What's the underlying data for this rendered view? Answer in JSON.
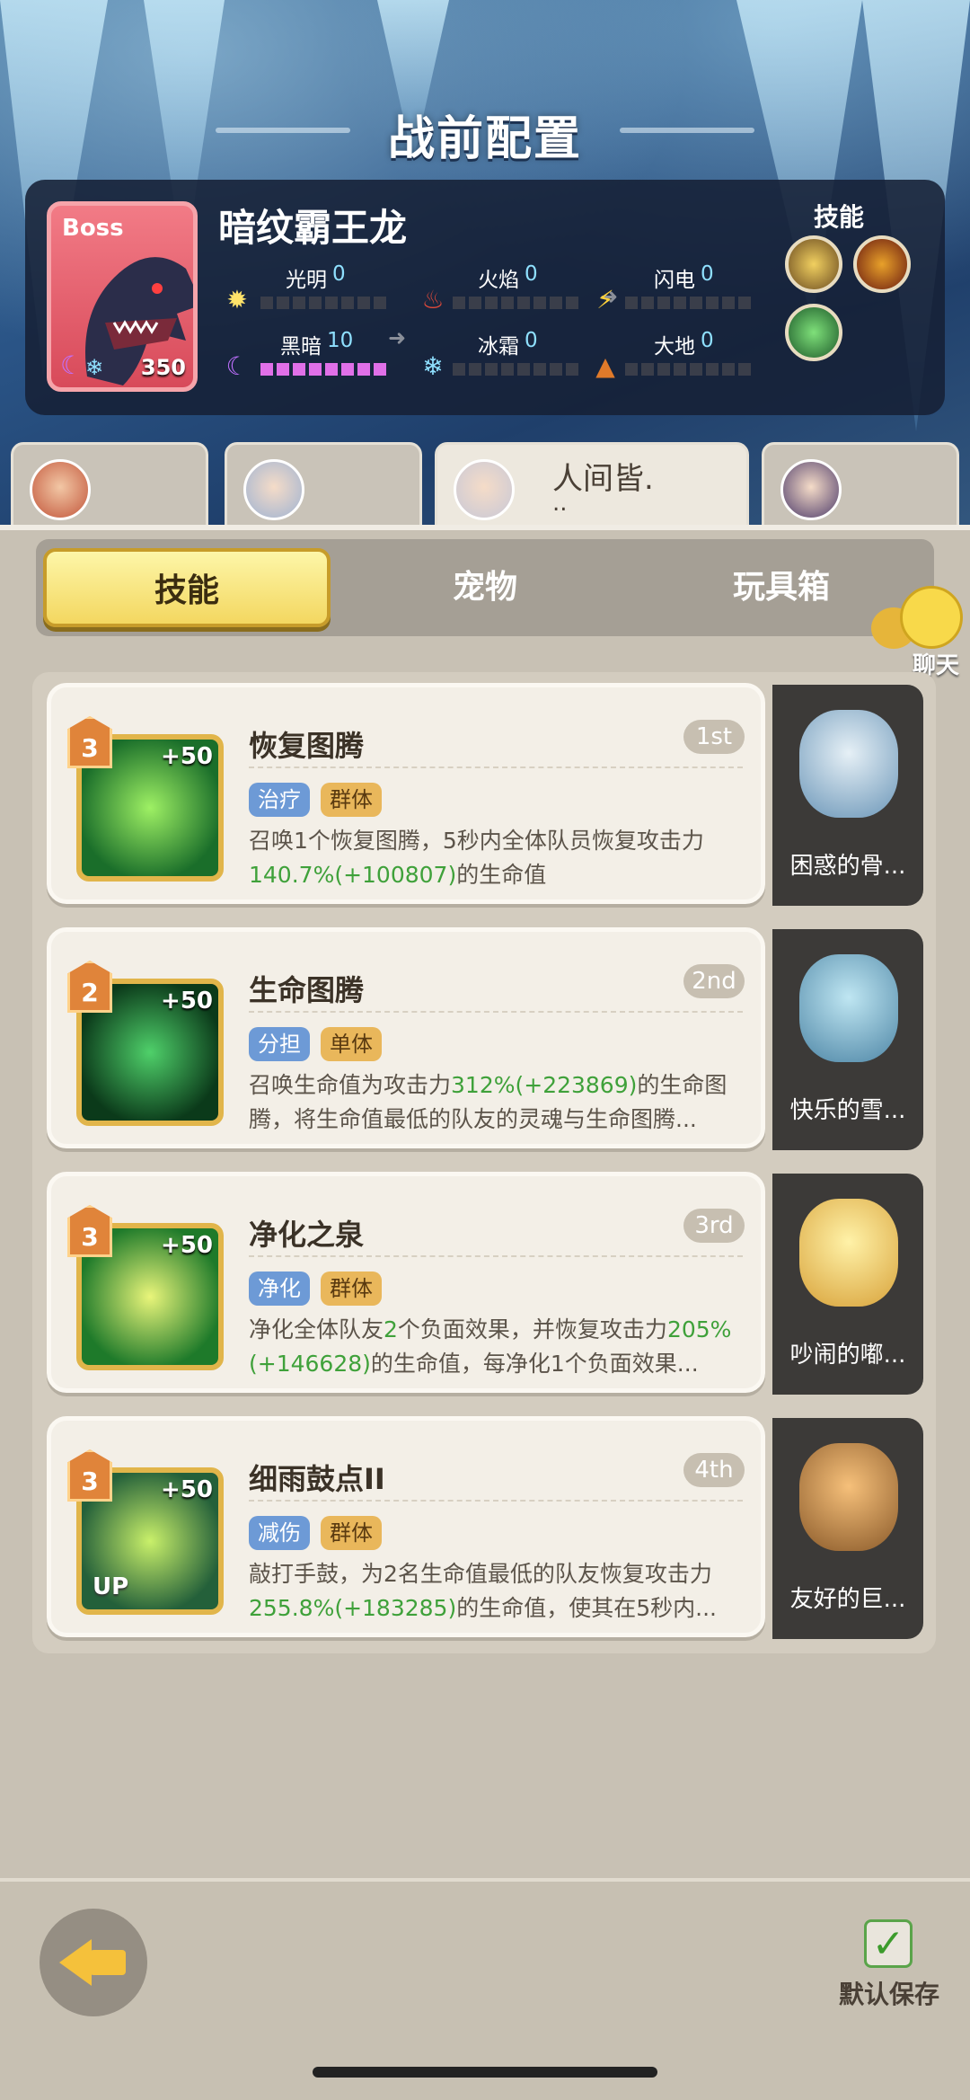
{
  "page": {
    "title": "战前配置"
  },
  "boss": {
    "tag": "Boss",
    "name": "暗纹霸王龙",
    "level": "350",
    "skills_label": "技能",
    "elements": [
      {
        "label": "光明",
        "value": "0",
        "icon": "sun-icon"
      },
      {
        "label": "火焰",
        "value": "0",
        "icon": "flame-icon"
      },
      {
        "label": "闪电",
        "value": "0",
        "icon": "lightning-icon"
      },
      {
        "label": "黑暗",
        "value": "10",
        "icon": "moon-icon"
      },
      {
        "label": "冰霜",
        "value": "0",
        "icon": "snowflake-icon"
      },
      {
        "label": "大地",
        "value": "0",
        "icon": "earth-icon"
      }
    ],
    "dark_fill": 1.0
  },
  "heroes": [
    {
      "name": "",
      "sub": ""
    },
    {
      "name": "",
      "sub": ""
    },
    {
      "name": "人间皆.",
      "sub": ".."
    },
    {
      "name": "",
      "sub": ""
    }
  ],
  "tabs": {
    "skills": "技能",
    "pets": "宠物",
    "toybox": "玩具箱"
  },
  "chat": {
    "label": "聊天"
  },
  "skills": [
    {
      "level": "3",
      "bonus": "+50",
      "name": "恢复图腾",
      "rank": "1st",
      "tags": [
        "治疗",
        "群体"
      ],
      "desc_a": "召唤1个恢复图腾，5秒内全体队员恢复攻击力",
      "desc_g1": "140.7%(+100807)",
      "desc_b": "的生命值",
      "desc_g2": "",
      "desc_c": "",
      "pet": "困惑的骨...",
      "up": ""
    },
    {
      "level": "2",
      "bonus": "+50",
      "name": "生命图腾",
      "rank": "2nd",
      "tags": [
        "分担",
        "单体"
      ],
      "desc_a": "召唤生命值为攻击力",
      "desc_g1": "312%(+223869)",
      "desc_b": "的生命图腾，将生命值最低的队友的灵魂与生命图腾...",
      "desc_g2": "",
      "desc_c": "",
      "pet": "快乐的雪...",
      "up": ""
    },
    {
      "level": "3",
      "bonus": "+50",
      "name": "净化之泉",
      "rank": "3rd",
      "tags": [
        "净化",
        "群体"
      ],
      "desc_a": "净化全体队友",
      "desc_g1": "2",
      "desc_b": "个负面效果，并恢复攻击力",
      "desc_g2": "205%(+146628)",
      "desc_c": "的生命值，每净化1个负面效果...",
      "pet": "吵闹的嘟...",
      "up": ""
    },
    {
      "level": "3",
      "bonus": "+50",
      "name": "细雨鼓点II",
      "rank": "4th",
      "tags": [
        "减伤",
        "群体"
      ],
      "desc_a": "敲打手鼓，为2名生命值最低的队友恢复攻击力",
      "desc_g1": "255.8%(+183285)",
      "desc_b": "的生命值，使其在5秒内...",
      "desc_g2": "",
      "desc_c": "",
      "pet": "友好的巨...",
      "up": "UP"
    }
  ],
  "footer": {
    "save_label": "默认保存",
    "save_checked": true
  }
}
